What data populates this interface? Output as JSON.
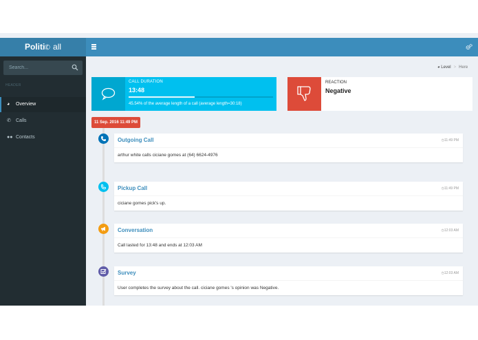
{
  "app": {
    "logo_bold": "Politi",
    "logo_rest": "all"
  },
  "search": {
    "placeholder": "Search..."
  },
  "sidebar": {
    "header": "HEADER",
    "items": [
      {
        "label": "Overview",
        "icon": "dashboard-icon",
        "active": true
      },
      {
        "label": "Calls",
        "icon": "phone-icon",
        "active": false
      },
      {
        "label": "Contacts",
        "icon": "users-icon",
        "active": false
      }
    ]
  },
  "breadcrumb": {
    "level": "Level",
    "here": "Here"
  },
  "call_box": {
    "title": "CALL DURATION",
    "value": "13:48",
    "progress_percent": 45.54,
    "description": "45.54% of the average length of a call (average length=30:18)"
  },
  "reaction_box": {
    "title": "REACTION",
    "value": "Negative",
    "icon": "thumbs-down-icon"
  },
  "timeline": {
    "date_label": "11 Sep. 2016 11:49 PM",
    "events": [
      {
        "title": "Outgoing Call",
        "time": "11:49 PM",
        "body": "arthur white calls ciciane gomes at (64) 6624-4976",
        "color": "#0073b7",
        "icon": "phone-icon"
      },
      {
        "title": "Pickup Call",
        "time": "11:49 PM",
        "body": "ciciane gomes pick's up.",
        "color": "#00c0ef",
        "icon": "phone-pickup-icon"
      },
      {
        "title": "Conversation",
        "time": "12:03 AM",
        "body": "Call lasted for 13:48 and ends at 12:03 AM",
        "color": "#f39c12",
        "icon": "bullhorn-icon"
      },
      {
        "title": "Survey",
        "time": "12:03 AM",
        "body": "User completes the survey about the call. ciciane gomes 's opinion was Negative.",
        "color": "#605ca8",
        "icon": "checkbox-icon"
      }
    ]
  }
}
